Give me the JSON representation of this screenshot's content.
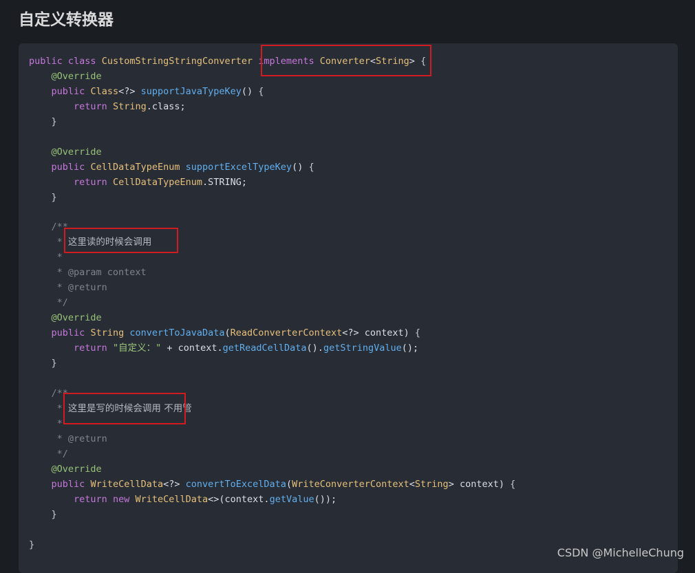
{
  "page": {
    "title": "自定义转换器"
  },
  "code": {
    "lines": [
      [
        [
          "kw",
          "public"
        ],
        [
          "plain",
          " "
        ],
        [
          "kw",
          "class"
        ],
        [
          "plain",
          " "
        ],
        [
          "cls",
          "CustomStringStringConverter"
        ],
        [
          "plain",
          " "
        ],
        [
          "kw",
          "implements"
        ],
        [
          "plain",
          " "
        ],
        [
          "cls",
          "Converter"
        ],
        [
          "plain",
          "<"
        ],
        [
          "cls",
          "String"
        ],
        [
          "plain",
          "> "
        ],
        [
          "brace",
          "{"
        ]
      ],
      [
        [
          "plain",
          "    "
        ],
        [
          "ann",
          "@Override"
        ]
      ],
      [
        [
          "plain",
          "    "
        ],
        [
          "kw",
          "public"
        ],
        [
          "plain",
          " "
        ],
        [
          "cls",
          "Class"
        ],
        [
          "plain",
          "<?> "
        ],
        [
          "fn",
          "supportJavaTypeKey"
        ],
        [
          "plain",
          "() "
        ],
        [
          "brace",
          "{"
        ]
      ],
      [
        [
          "plain",
          "        "
        ],
        [
          "kw",
          "return"
        ],
        [
          "plain",
          " "
        ],
        [
          "cls",
          "String"
        ],
        [
          "plain",
          ".class;"
        ]
      ],
      [
        [
          "plain",
          "    "
        ],
        [
          "brace",
          "}"
        ]
      ],
      [
        [
          "plain",
          ""
        ]
      ],
      [
        [
          "plain",
          "    "
        ],
        [
          "ann",
          "@Override"
        ]
      ],
      [
        [
          "plain",
          "    "
        ],
        [
          "kw",
          "public"
        ],
        [
          "plain",
          " "
        ],
        [
          "cls",
          "CellDataTypeEnum"
        ],
        [
          "plain",
          " "
        ],
        [
          "fn",
          "supportExcelTypeKey"
        ],
        [
          "plain",
          "() "
        ],
        [
          "brace",
          "{"
        ]
      ],
      [
        [
          "plain",
          "        "
        ],
        [
          "kw",
          "return"
        ],
        [
          "plain",
          " "
        ],
        [
          "cls",
          "CellDataTypeEnum"
        ],
        [
          "plain",
          ".STRING;"
        ]
      ],
      [
        [
          "plain",
          "    "
        ],
        [
          "brace",
          "}"
        ]
      ],
      [
        [
          "plain",
          ""
        ]
      ],
      [
        [
          "plain",
          "    "
        ],
        [
          "cm",
          "/**"
        ]
      ],
      [
        [
          "plain",
          "     "
        ],
        [
          "cm",
          "* "
        ],
        [
          "cm-cn",
          "这里读的时候会调用"
        ]
      ],
      [
        [
          "plain",
          "     "
        ],
        [
          "cm",
          "*"
        ]
      ],
      [
        [
          "plain",
          "     "
        ],
        [
          "cm",
          "* @param context"
        ]
      ],
      [
        [
          "plain",
          "     "
        ],
        [
          "cm",
          "* @return"
        ]
      ],
      [
        [
          "plain",
          "     "
        ],
        [
          "cm",
          "*/"
        ]
      ],
      [
        [
          "plain",
          "    "
        ],
        [
          "ann",
          "@Override"
        ]
      ],
      [
        [
          "plain",
          "    "
        ],
        [
          "kw",
          "public"
        ],
        [
          "plain",
          " "
        ],
        [
          "cls",
          "String"
        ],
        [
          "plain",
          " "
        ],
        [
          "fn",
          "convertToJavaData"
        ],
        [
          "plain",
          "("
        ],
        [
          "cls",
          "ReadConverterContext"
        ],
        [
          "plain",
          "<?> context) "
        ],
        [
          "brace",
          "{"
        ]
      ],
      [
        [
          "plain",
          "        "
        ],
        [
          "kw",
          "return"
        ],
        [
          "plain",
          " "
        ],
        [
          "str",
          "\"自定义：\""
        ],
        [
          "plain",
          " + context."
        ],
        [
          "fn",
          "getReadCellData"
        ],
        [
          "plain",
          "()."
        ],
        [
          "fn",
          "getStringValue"
        ],
        [
          "plain",
          "();"
        ]
      ],
      [
        [
          "plain",
          "    "
        ],
        [
          "brace",
          "}"
        ]
      ],
      [
        [
          "plain",
          ""
        ]
      ],
      [
        [
          "plain",
          "    "
        ],
        [
          "cm",
          "/**"
        ]
      ],
      [
        [
          "plain",
          "     "
        ],
        [
          "cm",
          "* "
        ],
        [
          "cm-cn",
          "这里是写的时候会调用 不用管"
        ]
      ],
      [
        [
          "plain",
          "     "
        ],
        [
          "cm",
          "*"
        ]
      ],
      [
        [
          "plain",
          "     "
        ],
        [
          "cm",
          "* @return"
        ]
      ],
      [
        [
          "plain",
          "     "
        ],
        [
          "cm",
          "*/"
        ]
      ],
      [
        [
          "plain",
          "    "
        ],
        [
          "ann",
          "@Override"
        ]
      ],
      [
        [
          "plain",
          "    "
        ],
        [
          "kw",
          "public"
        ],
        [
          "plain",
          " "
        ],
        [
          "cls",
          "WriteCellData"
        ],
        [
          "plain",
          "<?> "
        ],
        [
          "fn",
          "convertToExcelData"
        ],
        [
          "plain",
          "("
        ],
        [
          "cls",
          "WriteConverterContext"
        ],
        [
          "plain",
          "<"
        ],
        [
          "cls",
          "String"
        ],
        [
          "plain",
          "> context) "
        ],
        [
          "brace",
          "{"
        ]
      ],
      [
        [
          "plain",
          "        "
        ],
        [
          "kw",
          "return"
        ],
        [
          "plain",
          " "
        ],
        [
          "kw",
          "new"
        ],
        [
          "plain",
          " "
        ],
        [
          "cls",
          "WriteCellData"
        ],
        [
          "plain",
          "<>(context."
        ],
        [
          "fn",
          "getValue"
        ],
        [
          "plain",
          "());"
        ]
      ],
      [
        [
          "plain",
          "    "
        ],
        [
          "brace",
          "}"
        ]
      ],
      [
        [
          "plain",
          ""
        ]
      ],
      [
        [
          "brace",
          "}"
        ]
      ]
    ]
  },
  "colors": {
    "highlight_box": "#d21b21",
    "code_bg": "#282c34",
    "page_bg": "#1a1d21"
  },
  "watermark": "CSDN @MichelleChung"
}
